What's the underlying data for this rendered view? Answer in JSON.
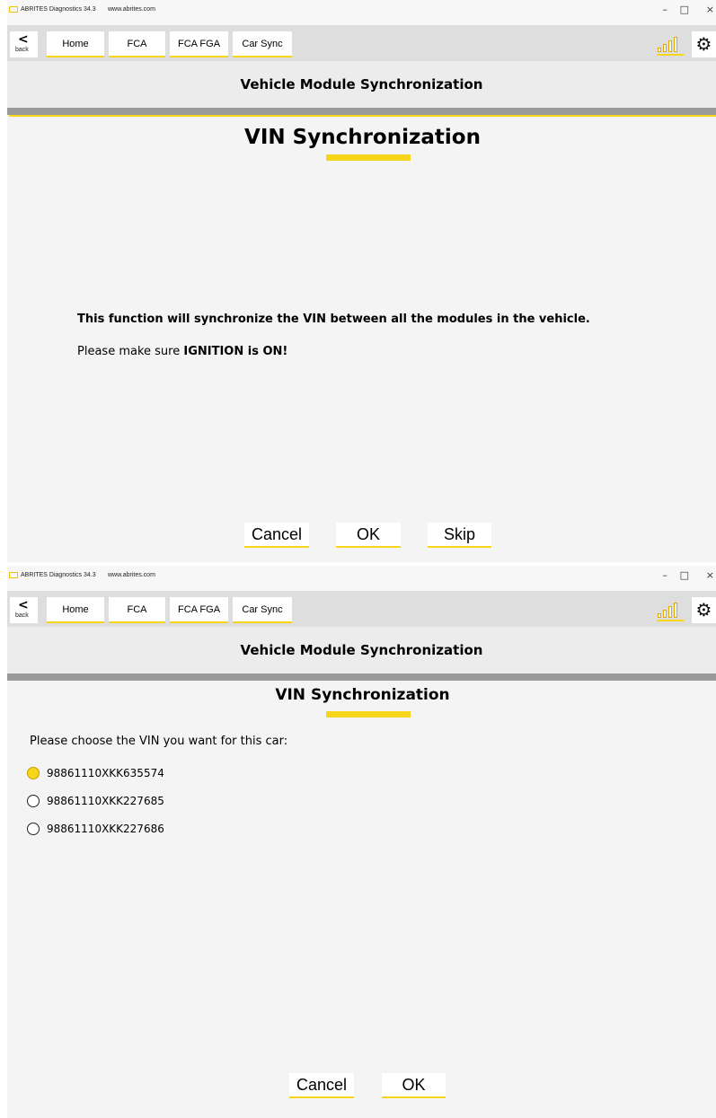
{
  "colors": {
    "accent": "#f7d51b",
    "toolbar": "#dedede",
    "header": "#ececec",
    "content": "#f4f4f4"
  },
  "window1": {
    "titlebar": {
      "title": "ABRITES Diagnostics 34.3",
      "url": "www.abrites.com",
      "minimize": "–",
      "maximize": "□",
      "close": "×"
    },
    "toolbar": {
      "back_icon": "<",
      "back_label": "back",
      "crumbs": [
        "Home",
        "FCA",
        "FCA FGA",
        "Car Sync"
      ],
      "gear_icon": "⚙"
    },
    "header": "Vehicle Module Synchronization",
    "panel": {
      "title": "VIN Synchronization",
      "message": "This function will synchronize the VIN between all the modules in the vehicle.",
      "note_prefix": "Please make sure ",
      "note_bold": "IGNITION is ON!"
    },
    "buttons": {
      "cancel": "Cancel",
      "ok": "OK",
      "skip": "Skip"
    }
  },
  "window2": {
    "titlebar": {
      "title": "ABRITES Diagnostics 34.3",
      "url": "www.abrites.com",
      "minimize": "–",
      "maximize": "□",
      "close": "×"
    },
    "toolbar": {
      "back_icon": "<",
      "back_label": "back",
      "crumbs": [
        "Home",
        "FCA",
        "FCA FGA",
        "Car Sync"
      ],
      "gear_icon": "⚙"
    },
    "header": "Vehicle Module Synchronization",
    "panel": {
      "title": "VIN Synchronization",
      "prompt": "Please choose the VIN you want for this car:",
      "options": [
        {
          "vin": "98861110XKK635574",
          "selected": true
        },
        {
          "vin": "98861110XKK227685",
          "selected": false
        },
        {
          "vin": "98861110XKK227686",
          "selected": false
        }
      ]
    },
    "buttons": {
      "cancel": "Cancel",
      "ok": "OK"
    }
  }
}
